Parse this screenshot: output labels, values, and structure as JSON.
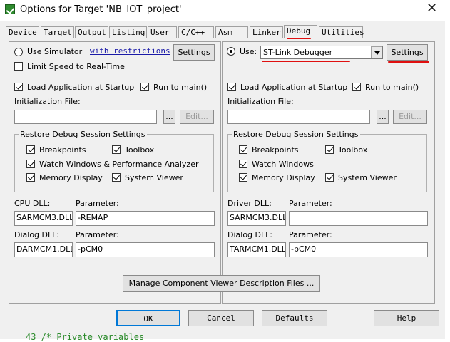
{
  "window": {
    "title": "Options for Target 'NB_IOT_project'",
    "close_glyph": "✕"
  },
  "tabs": [
    {
      "label": "Device"
    },
    {
      "label": "Target"
    },
    {
      "label": "Output"
    },
    {
      "label": "Listing"
    },
    {
      "label": "User"
    },
    {
      "label": "C/C++"
    },
    {
      "label": "Asm"
    },
    {
      "label": "Linker"
    },
    {
      "label": "Debug",
      "active": true
    },
    {
      "label": "Utilities"
    }
  ],
  "left": {
    "use_simulator": "Use Simulator",
    "restrictions_link": "with restrictions",
    "settings": "Settings",
    "limit_speed": "Limit Speed to Real-Time",
    "load_app": "Load Application at Startup",
    "run_to_main": "Run to main()",
    "init_file": "Initialization File:",
    "browse": "...",
    "edit": "Edit...",
    "restore_title": "Restore Debug Session Settings",
    "breakpoints": "Breakpoints",
    "toolbox": "Toolbox",
    "watch": "Watch Windows & Performance Analyzer",
    "memory": "Memory Display",
    "sysview": "System Viewer",
    "dll_label": "CPU DLL:",
    "param_label": "Parameter:",
    "dll_value": "SARMCM3.DLL",
    "param_value": "-REMAP",
    "dialog_dll_label": "Dialog DLL:",
    "dialog_param_label": "Parameter:",
    "dialog_dll_value": "DARMCM1.DLL",
    "dialog_param_value": "-pCM0"
  },
  "right": {
    "use_label": "Use:",
    "debugger": "ST-Link Debugger",
    "settings": "Settings",
    "load_app": "Load Application at Startup",
    "run_to_main": "Run to main()",
    "init_file": "Initialization File:",
    "browse": "...",
    "edit": "Edit...",
    "restore_title": "Restore Debug Session Settings",
    "breakpoints": "Breakpoints",
    "toolbox": "Toolbox",
    "watch": "Watch Windows",
    "memory": "Memory Display",
    "sysview": "System Viewer",
    "dll_label": "Driver DLL:",
    "param_label": "Parameter:",
    "dll_value": "SARMCM3.DLL",
    "param_value": "",
    "dialog_dll_label": "Dialog DLL:",
    "dialog_param_label": "Parameter:",
    "dialog_dll_value": "TARMCM1.DLL",
    "dialog_param_value": "-pCM0"
  },
  "manage_btn": "Manage Component Viewer Description Files ...",
  "footer": {
    "ok": "OK",
    "cancel": "Cancel",
    "defaults": "Defaults",
    "help": "Help"
  },
  "background_code": "43 /* Private variables",
  "colors": {
    "annotation_red": "#e01010",
    "link_blue": "#1a1aa8",
    "dialog_bg": "#f0f0f0"
  }
}
